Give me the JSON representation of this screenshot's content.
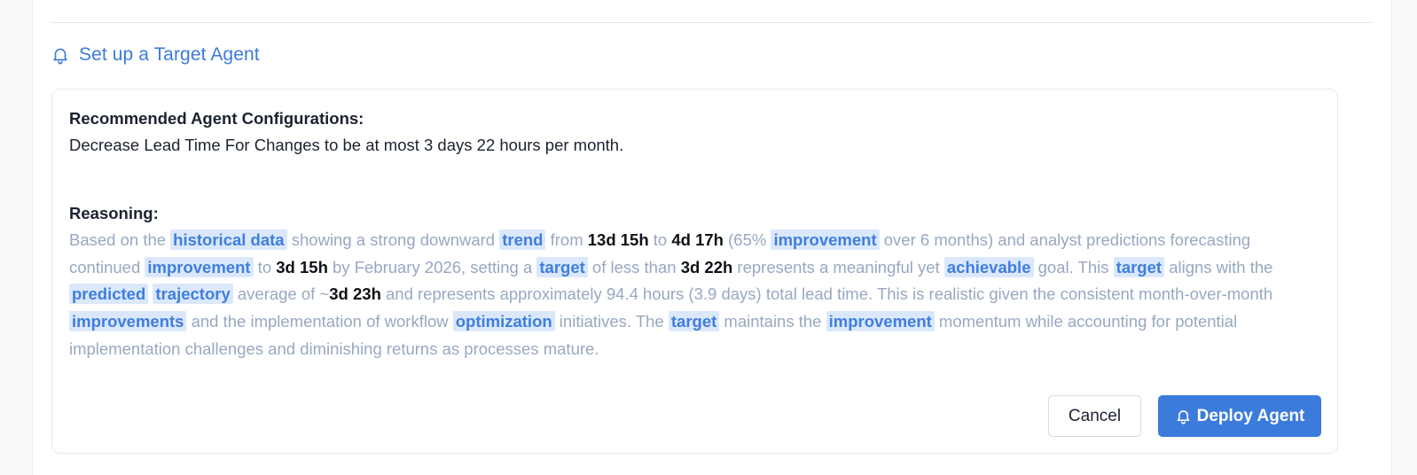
{
  "section": {
    "title": "Set up a Target Agent",
    "icon": "bell-icon",
    "accent_color": "#3b7bdb"
  },
  "card": {
    "config_label": "Recommended Agent Configurations:",
    "config_text": "Decrease Lead Time For Changes to be at most 3 days 22 hours per month.",
    "reasoning_label": "Reasoning:",
    "reasoning_segments": [
      {
        "t": "text",
        "v": "Based on the "
      },
      {
        "t": "kw",
        "v": "historical data"
      },
      {
        "t": "text",
        "v": " showing a strong downward "
      },
      {
        "t": "kw",
        "v": "trend"
      },
      {
        "t": "text",
        "v": " from "
      },
      {
        "t": "num",
        "v": "13d 15h"
      },
      {
        "t": "text",
        "v": " to "
      },
      {
        "t": "num",
        "v": "4d 17h"
      },
      {
        "t": "text",
        "v": " (65% "
      },
      {
        "t": "kw",
        "v": "improvement"
      },
      {
        "t": "text",
        "v": " over 6 months) and analyst predictions forecasting continued "
      },
      {
        "t": "kw",
        "v": "improvement"
      },
      {
        "t": "text",
        "v": " to "
      },
      {
        "t": "num",
        "v": "3d 15h"
      },
      {
        "t": "text",
        "v": " by February 2026, setting a "
      },
      {
        "t": "kw",
        "v": "target"
      },
      {
        "t": "text",
        "v": " of less than "
      },
      {
        "t": "num",
        "v": "3d 22h"
      },
      {
        "t": "text",
        "v": " represents a meaningful yet "
      },
      {
        "t": "kw",
        "v": "achievable"
      },
      {
        "t": "text",
        "v": " goal. This "
      },
      {
        "t": "kw",
        "v": "target"
      },
      {
        "t": "text",
        "v": " aligns with the "
      },
      {
        "t": "kw",
        "v": "predicted"
      },
      {
        "t": "text",
        "v": " "
      },
      {
        "t": "kw",
        "v": "trajectory"
      },
      {
        "t": "text",
        "v": " average of ~"
      },
      {
        "t": "num",
        "v": "3d 23h"
      },
      {
        "t": "text",
        "v": " and represents approximately 94.4 hours (3.9 days) total lead time. This is realistic given the consistent month-over-month "
      },
      {
        "t": "kw",
        "v": "improvements"
      },
      {
        "t": "text",
        "v": " and the implementation of workflow "
      },
      {
        "t": "kw",
        "v": "optimization"
      },
      {
        "t": "text",
        "v": " initiatives. The "
      },
      {
        "t": "kw",
        "v": "target"
      },
      {
        "t": "text",
        "v": " maintains the "
      },
      {
        "t": "kw",
        "v": "improvement"
      },
      {
        "t": "text",
        "v": " momentum while accounting for potential implementation challenges and diminishing returns as processes mature."
      }
    ]
  },
  "actions": {
    "cancel_label": "Cancel",
    "deploy_label": "Deploy Agent",
    "deploy_icon": "bell-icon"
  }
}
